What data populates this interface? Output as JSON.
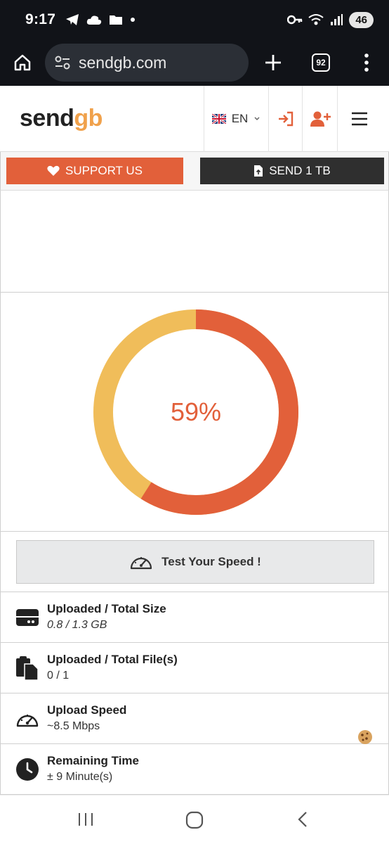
{
  "status_bar": {
    "time": "9:17",
    "battery": "46"
  },
  "browser": {
    "url": "sendgb.com",
    "tab_count": "92"
  },
  "header": {
    "logo_main": "send",
    "logo_accent": "gb",
    "language": "EN"
  },
  "actions": {
    "support_label": "SUPPORT US",
    "send_label": "SEND 1 TB"
  },
  "progress": {
    "percent_label": "59%",
    "percent_value": 59
  },
  "speed_test": {
    "label": "Test Your Speed !"
  },
  "stats": [
    {
      "title": "Uploaded / Total Size",
      "value": "0.8 / 1.3 GB"
    },
    {
      "title": "Uploaded / Total File(s)",
      "value": "0 / 1"
    },
    {
      "title": "Upload Speed",
      "value": "~8.5 Mbps"
    },
    {
      "title": "Remaining Time",
      "value": "± 9 Minute(s)"
    }
  ],
  "colors": {
    "accent": "#e2603a",
    "ring_track": "#f0bd5a",
    "dark": "#2f2f2f"
  }
}
